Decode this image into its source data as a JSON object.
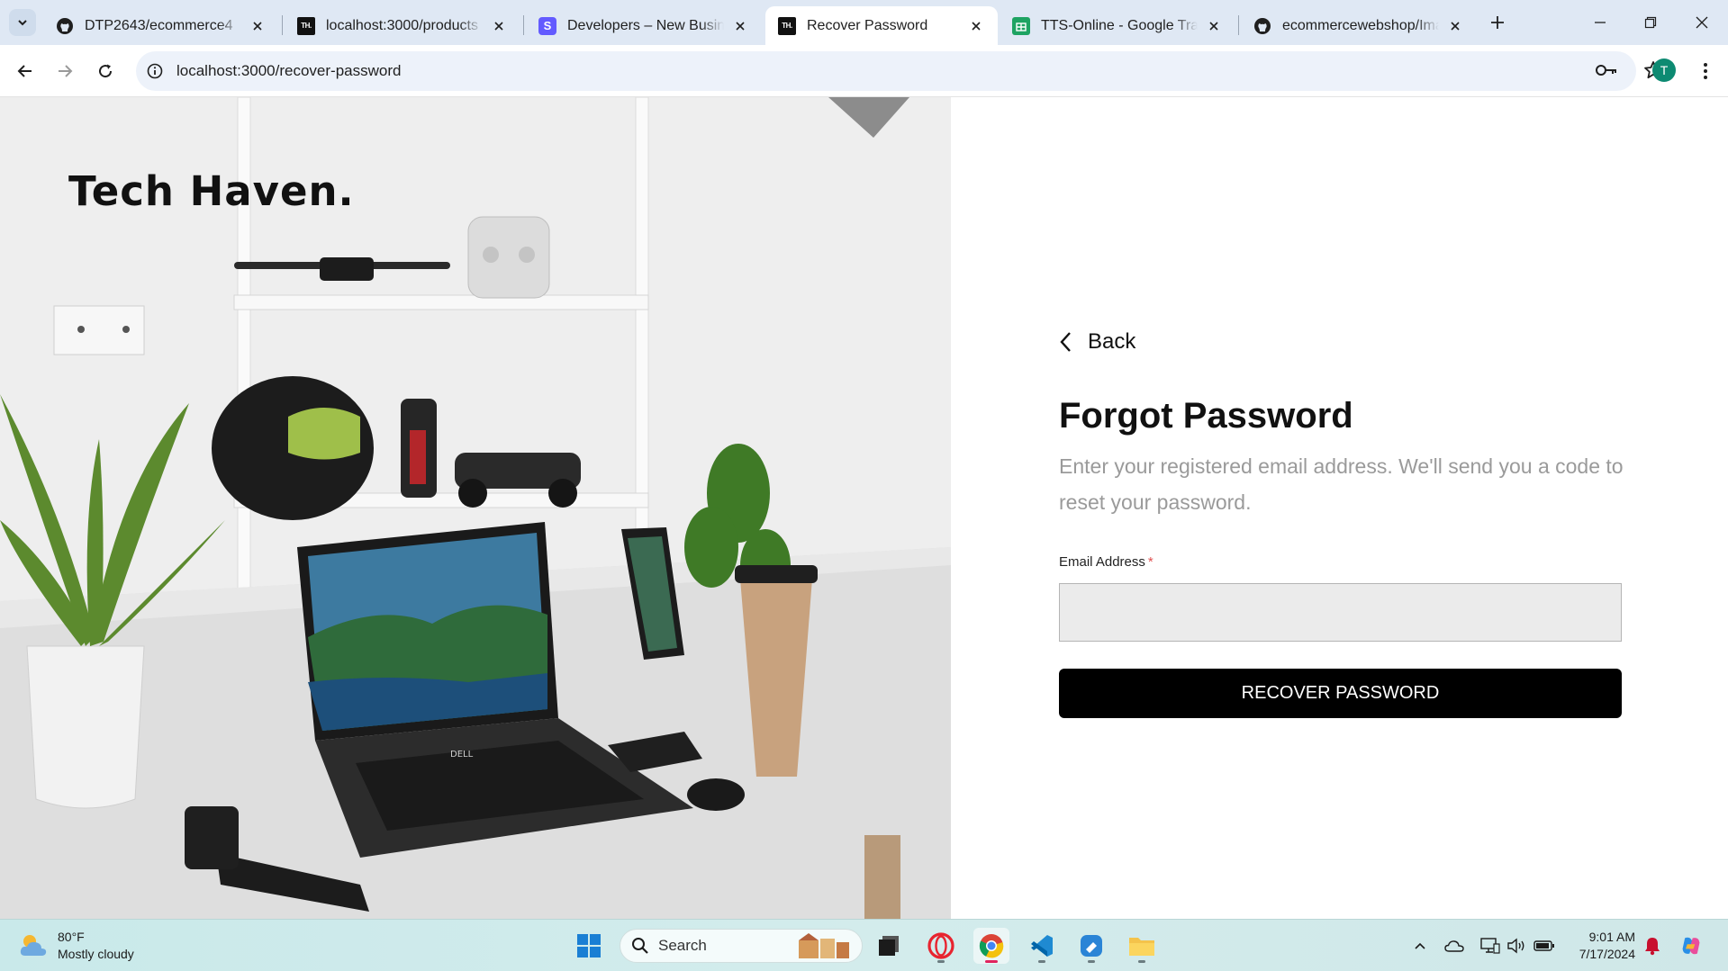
{
  "browser": {
    "tabs": [
      {
        "title": "DTP2643/ecommerce4",
        "icon": "github-icon",
        "active": false
      },
      {
        "title": "localhost:3000/products",
        "icon": "techhaven-icon",
        "active": false
      },
      {
        "title": "Developers – New Business",
        "icon": "stripe-icon",
        "active": false
      },
      {
        "title": "Recover Password",
        "icon": "techhaven-icon",
        "active": true
      },
      {
        "title": "TTS-Online - Google Trang",
        "icon": "sheets-icon",
        "active": false
      },
      {
        "title": "ecommercewebshop/Imag",
        "icon": "github-icon",
        "active": false
      }
    ],
    "favicon_text": "TH.",
    "stripe_favicon_text": "S",
    "url": "localhost:3000/recover-password",
    "profile_initial": "T"
  },
  "hero": {
    "brand": "Tech Haven.",
    "laptop_logo": "DELL"
  },
  "form": {
    "back_label": "Back",
    "heading": "Forgot Password",
    "description": "Enter your registered email address. We'll send you a code to reset your password.",
    "email_label": "Email Address",
    "required_mark": "*",
    "email_value": "",
    "submit_label": "RECOVER PASSWORD"
  },
  "taskbar": {
    "weather_temp": "80°F",
    "weather_desc": "Mostly cloudy",
    "search_label": "Search",
    "time": "9:01 AM",
    "date": "7/17/2024",
    "pinned_apps": [
      "windows-start-icon",
      "file-manager-icon",
      "opera-icon",
      "chrome-icon",
      "vscode-icon",
      "feedback-app-icon",
      "file-explorer-icon"
    ],
    "tray_icons": [
      "chevron-up-icon",
      "onedrive-icon",
      "network-icon",
      "volume-icon",
      "battery-icon",
      "notification-bell-icon",
      "copilot-icon"
    ]
  },
  "colors": {
    "accent": "#000000",
    "required": "#e05050",
    "tabstrip_bg": "#dfe8f4",
    "omnibox_bg": "#edf2fa"
  }
}
